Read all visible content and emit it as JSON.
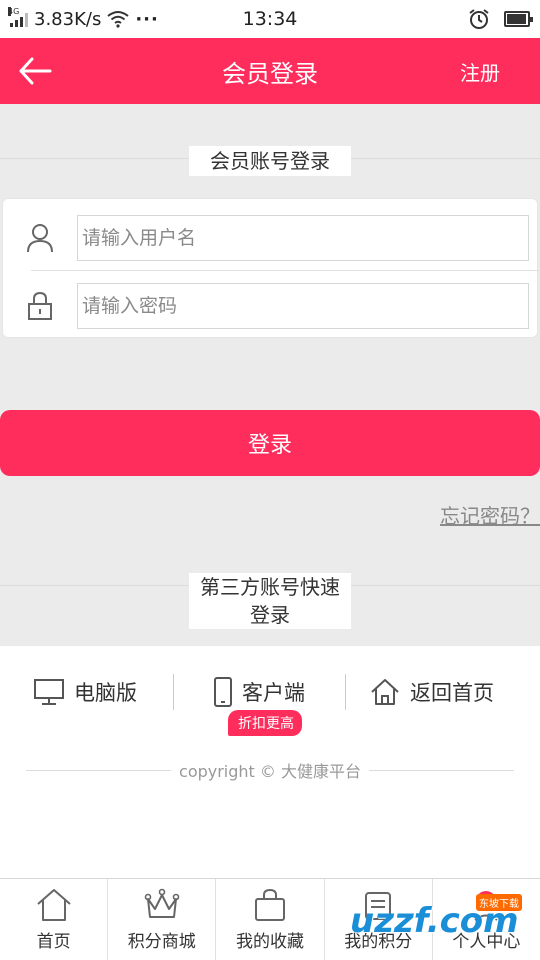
{
  "status_bar": {
    "network_type": "4G",
    "speed": "3.83K/s",
    "more": "···",
    "time": "13:34",
    "battery_level": 0.85
  },
  "header": {
    "title": "会员登录",
    "register_label": "注册",
    "back_icon": "arrow-left-icon"
  },
  "login": {
    "section_title": "会员账号登录",
    "username_placeholder": "请输入用户名",
    "password_placeholder": "请输入密码",
    "submit_label": "登录",
    "forgot_label": "忘记密码？"
  },
  "third_party": {
    "section_title_line1": "第三方账号快速",
    "section_title_line2": "登录"
  },
  "platforms": {
    "desktop_label": "电脑版",
    "client_label": "客户端",
    "client_badge": "折扣更高",
    "home_label": "返回首页"
  },
  "footer": {
    "copyright": "copyright © 大健康平台"
  },
  "bottom_nav": [
    {
      "label": "首页",
      "icon": "home-icon"
    },
    {
      "label": "积分商城",
      "icon": "crown-icon"
    },
    {
      "label": "我的收藏",
      "icon": "bag-icon"
    },
    {
      "label": "我的积分",
      "icon": "points-icon"
    },
    {
      "label": "个人中心",
      "icon": "user-center-icon"
    }
  ],
  "colors": {
    "brand": "#ff2d5c",
    "background": "#ebebeb"
  }
}
